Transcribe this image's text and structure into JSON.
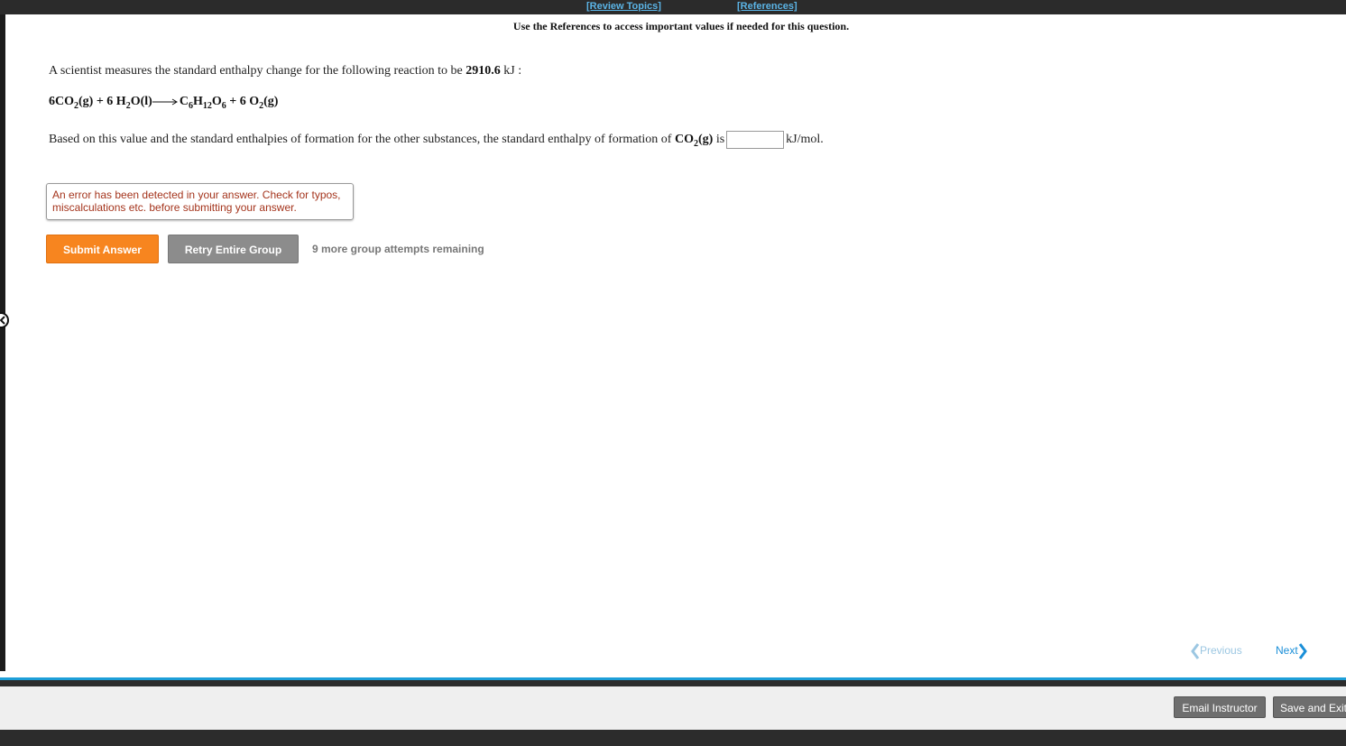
{
  "topbar": {
    "review_topics": "[Review Topics]",
    "references": "[References]"
  },
  "reference_note": "Use the References to access important values if needed for this question.",
  "question": {
    "intro_before": "A scientist measures the standard enthalpy change for the following reaction to be ",
    "value": "2910.6",
    "unit": " kJ :"
  },
  "reaction": {
    "lhs_1": "6CO",
    "lhs_1_sub": "2",
    "lhs_1_state": "(g) + 6 H",
    "lhs_2_sub": "2",
    "lhs_2_rest": "O(l)",
    "rhs_1": "C",
    "rhs_1_sub": "6",
    "rhs_2": "H",
    "rhs_2_sub": "12",
    "rhs_3": "O",
    "rhs_3_sub": "6",
    "rhs_4": " + 6 O",
    "rhs_4_sub": "2",
    "rhs_4_state": "(g)"
  },
  "based": {
    "text_before": "Based on this value and the standard enthalpies of formation for the other substances, the standard enthalpy of formation of ",
    "species": "CO",
    "species_sub": "2",
    "species_state": "(g)",
    "is": " is",
    "unit": "kJ/mol."
  },
  "answer": {
    "value": ""
  },
  "error_message": "An error has been detected in your answer. Check for typos, miscalculations etc. before submitting your answer.",
  "buttons": {
    "submit": "Submit Answer",
    "retry": "Retry Entire Group"
  },
  "attempts_text": "9 more group attempts remaining",
  "nav": {
    "previous": "Previous",
    "next": "Next"
  },
  "footer": {
    "email_instructor": "Email Instructor",
    "save_and_exit": "Save and Exit"
  },
  "colors": {
    "submit": "#f7851f",
    "retry": "#8c8c8c",
    "link": "#5bb4e6",
    "error_text": "#a4341c",
    "accent_line": "#1e9fd8"
  }
}
